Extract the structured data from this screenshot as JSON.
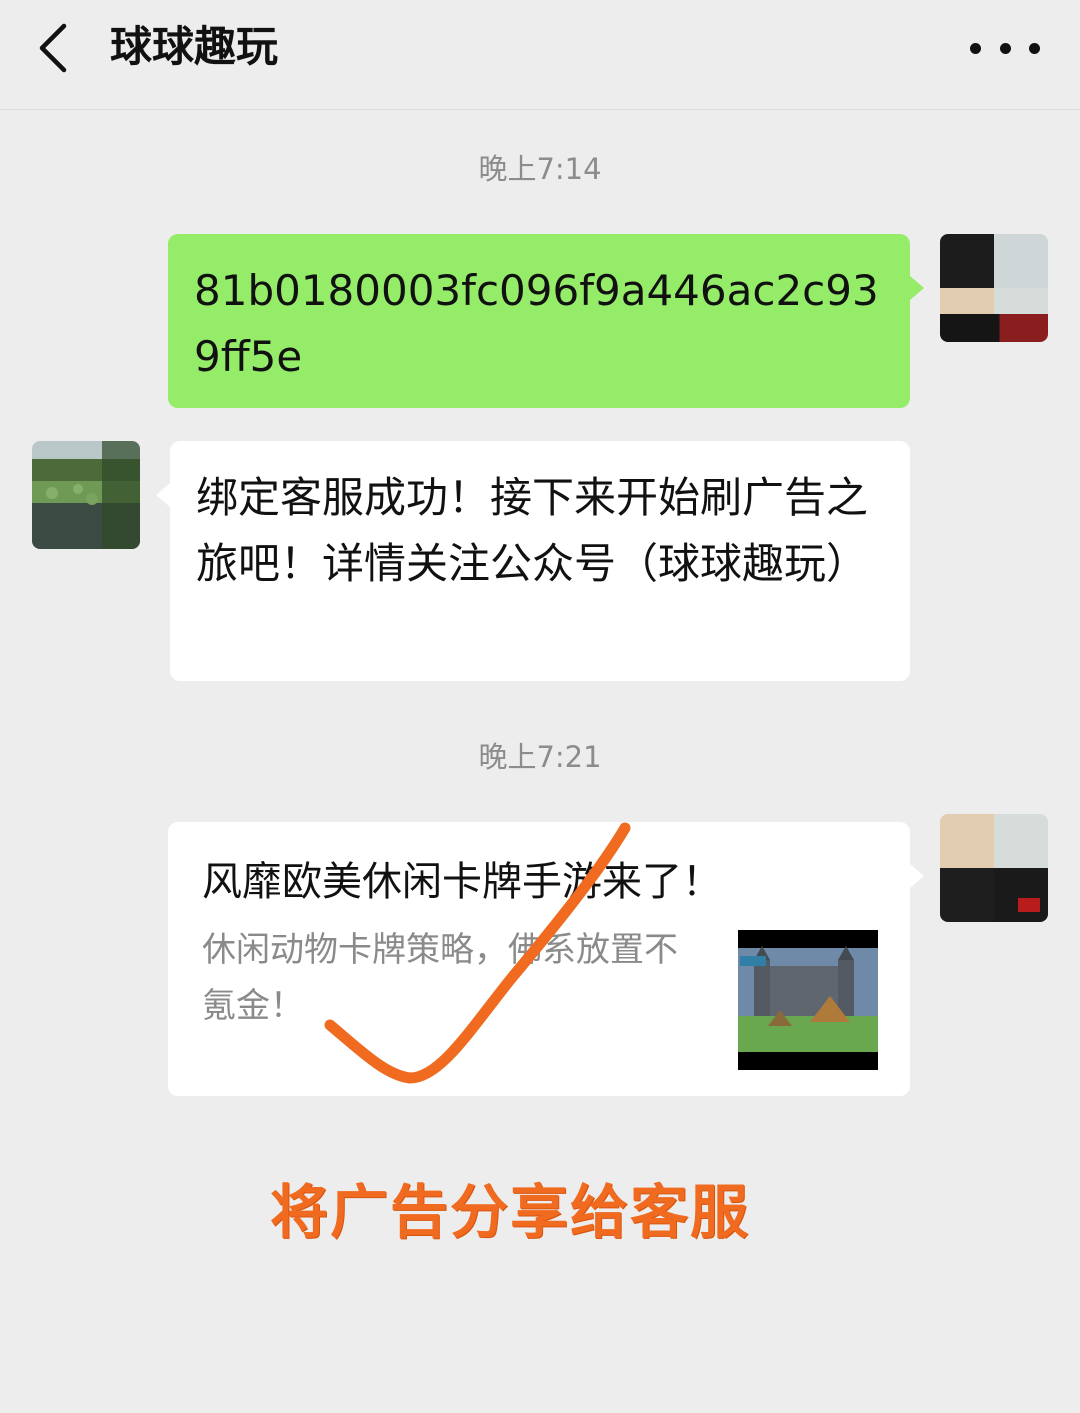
{
  "header": {
    "title": "球球趣玩",
    "back_icon": "chevron-left-icon",
    "more_icon": "more-dots-icon"
  },
  "messages": [
    {
      "type": "timestamp",
      "text": "晚上7:14"
    },
    {
      "type": "outgoing-text",
      "text": "81b0180003fc096f9a446ac2c939ff5e"
    },
    {
      "type": "incoming-text",
      "text": "绑定客服成功！接下来开始刷广告之旅吧！详情关注公众号（球球趣玩）"
    },
    {
      "type": "timestamp",
      "text": "晚上7:21"
    },
    {
      "type": "outgoing-card",
      "title": "风靡欧美休闲卡牌手游来了！",
      "description": "休闲动物卡牌策略，佛系放置不氪金！"
    }
  ],
  "annotation": {
    "caption": "将广告分享给客服",
    "mark_icon": "checkmark-annotation-icon",
    "color": "#f06a1f"
  },
  "colors": {
    "background": "#ededed",
    "outgoing_bubble": "#95ec69",
    "incoming_bubble": "#ffffff",
    "timestamp": "#8c8c8c"
  }
}
